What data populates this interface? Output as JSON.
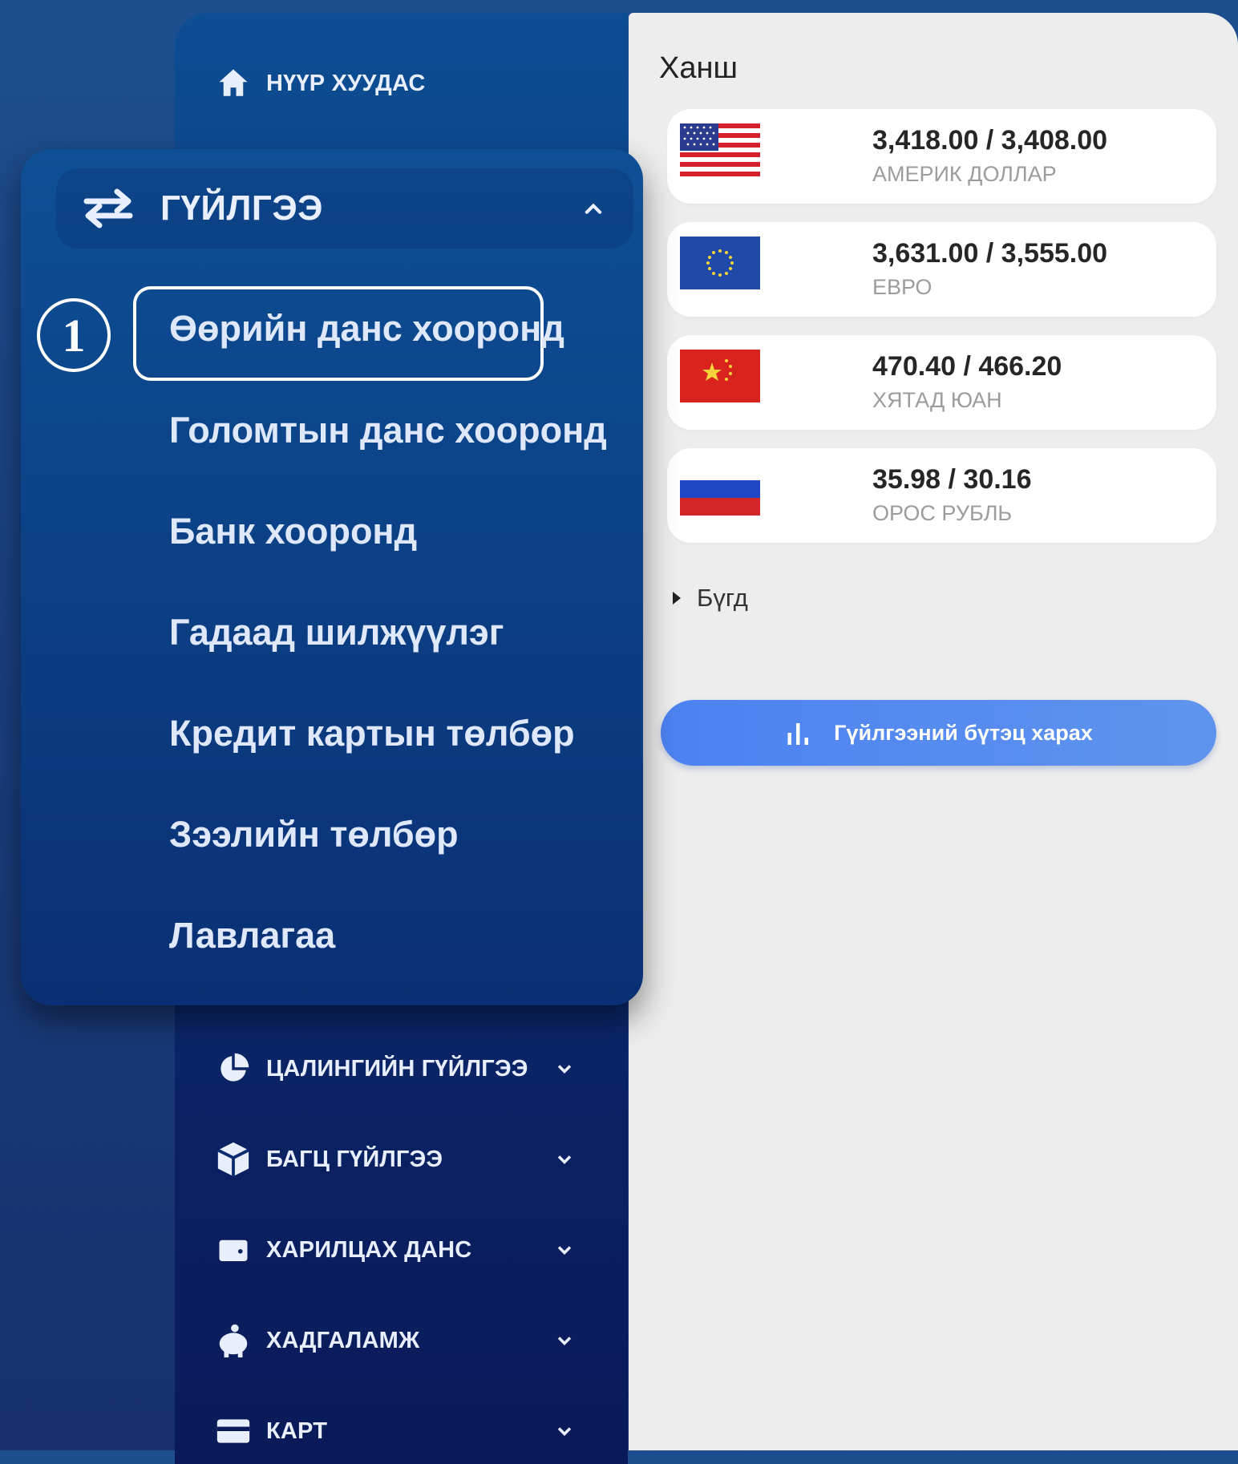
{
  "sidebar": {
    "items": [
      {
        "label": "НҮҮР ХУУДАС",
        "icon": "home-icon"
      },
      {
        "label": "ЦАЛИНГИЙН ГҮЙЛГЭЭ",
        "icon": "pie-chart-icon"
      },
      {
        "label": "БАГЦ ГҮЙЛГЭЭ",
        "icon": "package-icon"
      },
      {
        "label": "ХАРИЛЦАХ ДАНС",
        "icon": "wallet-icon"
      },
      {
        "label": "ХАДГАЛАМЖ",
        "icon": "piggy-bank-icon"
      },
      {
        "label": "КАРТ",
        "icon": "card-icon"
      }
    ]
  },
  "popup": {
    "header_label": "ГҮЙЛГЭЭ",
    "header_icon": "transfer-arrows-icon",
    "step_number": "1",
    "items": [
      "Өөрийн данс хооронд",
      "Голомтын данс хооронд",
      "Банк хооронд",
      "Гадаад шилжүүлэг",
      "Кредит картын төлбөр",
      "Зээлийн төлбөр",
      "Лавлагаа"
    ]
  },
  "rates": {
    "title": "Ханш",
    "list": [
      {
        "value": "3,418.00 / 3,408.00",
        "name": "АМЕРИК ДОЛЛАР",
        "flag": "us-flag-icon"
      },
      {
        "value": "3,631.00 / 3,555.00",
        "name": "ЕВРО",
        "flag": "eu-flag-icon"
      },
      {
        "value": "470.40 / 466.20",
        "name": "ХЯТАД ЮАН",
        "flag": "cn-flag-icon"
      },
      {
        "value": "35.98 / 30.16",
        "name": "ОРОС РУБЛЬ",
        "flag": "ru-flag-icon"
      }
    ],
    "all_label": "Бүгд",
    "cta_label": "Гүйлгээний бүтэц харах"
  },
  "colors": {
    "sidebar_top": "#0d4d93",
    "sidebar_bottom": "#0a1a58",
    "cta": "#5389ef",
    "panel_bg": "#ededed"
  }
}
